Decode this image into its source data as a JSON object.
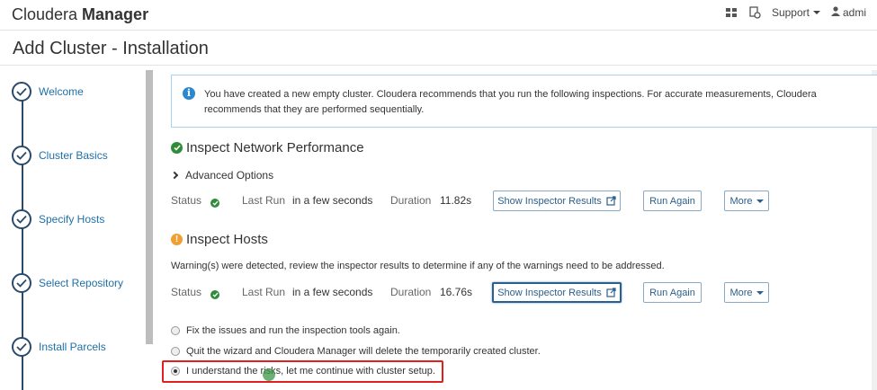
{
  "app": {
    "brand_light": "Cloudera ",
    "brand_bold": "Manager"
  },
  "topbar": {
    "support_label": "Support",
    "user_label": "admi"
  },
  "page": {
    "title": "Add Cluster - Installation"
  },
  "steps": [
    {
      "label": "Welcome"
    },
    {
      "label": "Cluster Basics"
    },
    {
      "label": "Specify Hosts"
    },
    {
      "label": "Select Repository"
    },
    {
      "label": "Install Parcels"
    }
  ],
  "info": {
    "text": "You have created a new empty cluster. Cloudera recommends that you run the following inspections. For accurate measurements, Cloudera recommends that they are performed sequentially."
  },
  "network": {
    "title": "Inspect Network Performance",
    "advanced_label": "Advanced Options",
    "status_label": "Status",
    "last_run_label": "Last Run",
    "last_run_value": "in a few seconds",
    "duration_label": "Duration",
    "duration_value": "11.82s",
    "show_results_label": "Show Inspector Results",
    "run_again_label": "Run Again",
    "more_label": "More"
  },
  "hosts": {
    "title": "Inspect Hosts",
    "warning": "Warning(s) were detected, review the inspector results to determine if any of the warnings need to be addressed.",
    "status_label": "Status",
    "last_run_label": "Last Run",
    "last_run_value": "in a few seconds",
    "duration_label": "Duration",
    "duration_value": "16.76s",
    "show_results_label": "Show Inspector Results",
    "run_again_label": "Run Again",
    "more_label": "More"
  },
  "options": [
    {
      "label": "Fix the issues and run the inspection tools again.",
      "checked": false
    },
    {
      "label": "Quit the wizard and Cloudera Manager will delete the temporarily created cluster.",
      "checked": false
    },
    {
      "label": "I understand the risks, let me continue with cluster setup.",
      "checked": true
    }
  ],
  "colors": {
    "accent": "#2b5f8c",
    "ok": "#2f8d3a",
    "warn": "#f0a030",
    "info": "#2a88d0",
    "highlight": "#e02020"
  }
}
